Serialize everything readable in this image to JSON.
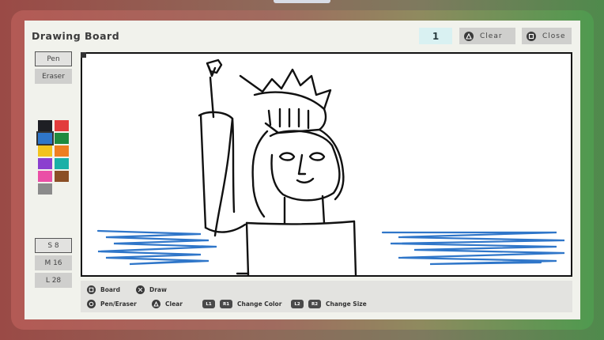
{
  "header": {
    "title": "Drawing Board",
    "page_count": "1",
    "clear_label": "Clear",
    "close_label": "Close"
  },
  "tools": {
    "pen_label": "Pen",
    "eraser_label": "Eraser",
    "selected": "Pen"
  },
  "palette": {
    "colors": [
      "#1e1f24",
      "#e23c3c",
      "#2f76c9",
      "#1f8a3f",
      "#f2c31e",
      "#ef7f22",
      "#8b3fcf",
      "#1ab0a7",
      "#ea4fa6",
      "#8b4f26",
      "#8b8b8b"
    ],
    "selected_index": 2
  },
  "sizes": {
    "items": [
      {
        "label": "S 8"
      },
      {
        "label": "M 16"
      },
      {
        "label": "L 28"
      }
    ],
    "selected_index": 0
  },
  "hints": {
    "board": "Board",
    "draw": "Draw",
    "pen_eraser": "Pen/Eraser",
    "clear": "Clear",
    "l1": "L1",
    "r1": "R1",
    "change_color": "Change Color",
    "l2": "L2",
    "r2": "R2",
    "change_size": "Change Size"
  }
}
